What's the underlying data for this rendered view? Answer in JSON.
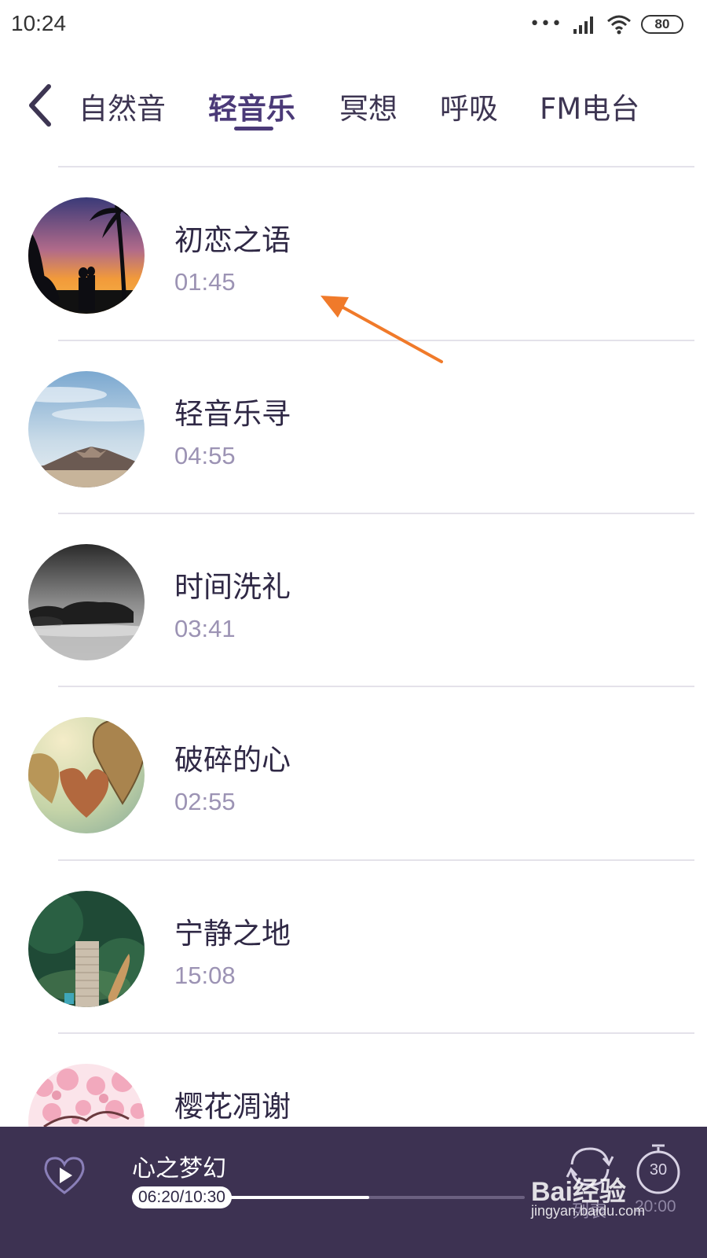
{
  "status_bar": {
    "time": "10:24",
    "battery": "80",
    "icons": [
      "more-dots-icon",
      "signal-icon",
      "wifi-icon",
      "battery-icon"
    ]
  },
  "tabs": {
    "items": [
      {
        "label": "自然音",
        "active": false
      },
      {
        "label": "轻音乐",
        "active": true
      },
      {
        "label": "冥想",
        "active": false
      },
      {
        "label": "呼吸",
        "active": false
      },
      {
        "label": "FM电台",
        "active": false
      }
    ]
  },
  "tracks": [
    {
      "title": "初恋之语",
      "duration": "01:45",
      "cover": "sunset-couple-cover"
    },
    {
      "title": "轻音乐寻",
      "duration": "04:55",
      "cover": "mountain-sky-cover"
    },
    {
      "title": "时间洗礼",
      "duration": "03:41",
      "cover": "misty-rocks-cover"
    },
    {
      "title": "破碎的心",
      "duration": "02:55",
      "cover": "wooden-hearts-cover"
    },
    {
      "title": "宁静之地",
      "duration": "15:08",
      "cover": "pier-boat-cover"
    },
    {
      "title": "樱花凋谢",
      "duration": "",
      "cover": "cherry-blossom-cover"
    }
  ],
  "player": {
    "title": "心之梦幻",
    "time": "06:20/10:30",
    "progress": 0.6032,
    "mode_label": "列表",
    "timer_value": "30",
    "timer_label": "20:00"
  },
  "watermark": {
    "logo": "Bai经验",
    "url": "jingyan.baidu.com"
  },
  "colors": {
    "accent": "#4b3a78",
    "player_bg": "#3d3252",
    "duration_text": "#9c93b4",
    "annotation_arrow": "#f07a2a"
  }
}
